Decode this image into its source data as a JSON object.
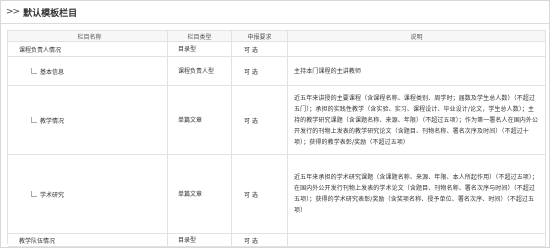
{
  "header": {
    "arrow": ">>",
    "title": "默认模板栏目"
  },
  "table": {
    "headers": {
      "name": "栏目名称",
      "type": "栏目类型",
      "req": "申报要求",
      "desc": "说明"
    },
    "rows": [
      {
        "name": "课程负责人情况",
        "type": "目录型",
        "req": "可 选",
        "desc": ""
      },
      {
        "name": "基本信息",
        "type": "课程负责人型",
        "req": "可 选",
        "desc": "主持本门课程的主讲教师"
      },
      {
        "name": "教学情况",
        "type": "单篇文章",
        "req": "可 选",
        "desc": "近五年来讲授的主要课程（含课程名称、课程类别、周学时；届数及学生总人数）（不超过五门）；承担的实践性教学（含实验、实习、课程设计、毕业设计/论文，学生总人数）；主持的教学研究课题（含课题名称、来源、年限）（不超过五项）；作为第一署名人在国内外公开发行的刊物上发表的教学研究论文（含题目、刊物名称、署名次序及时间）（不超过十项）；获得的教学表彰/奖励（不超过五项）"
      },
      {
        "name": "学术研究",
        "type": "单篇文章",
        "req": "可 选",
        "desc": "近五年来承担的学术研究课题（含课题名称、来源、年限、本人所起作用）（不超过五项）；在国内外公开发行刊物上发表的学术论文（含题目、刊物名称、署名次序与时间）（不超过五项）；获得的学术研究表彰/奖励（含奖项名称、授予单位、署名次序、时间）（不超过五项）"
      },
      {
        "name": "教学队伍情况",
        "type": "目录型",
        "req": "可 选",
        "desc": ""
      }
    ]
  }
}
